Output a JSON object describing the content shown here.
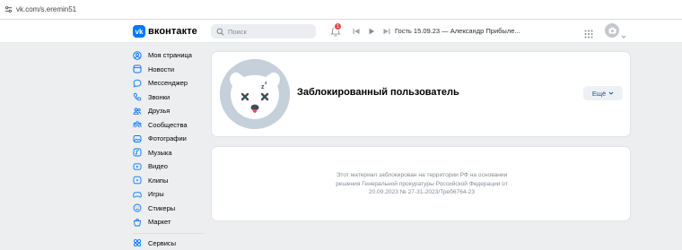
{
  "browser": {
    "url": "vk.com/s.eremin51"
  },
  "header": {
    "logo_text": "вконтакте",
    "logo_mark": "vk",
    "search_placeholder": "Поиск",
    "notification_count": "1",
    "now_playing": "Гость 15.09.23 — Александр Прибыле...",
    "accent_color": "#0077ff"
  },
  "sidebar": {
    "items": [
      {
        "label": "Моя страница",
        "icon": "user-circle-icon"
      },
      {
        "label": "Новости",
        "icon": "newsfeed-icon"
      },
      {
        "label": "Мессенджер",
        "icon": "message-icon"
      },
      {
        "label": "Звонки",
        "icon": "phone-icon"
      },
      {
        "label": "Друзья",
        "icon": "friends-icon"
      },
      {
        "label": "Сообщества",
        "icon": "groups-icon"
      },
      {
        "label": "Фотографии",
        "icon": "photo-icon"
      },
      {
        "label": "Музыка",
        "icon": "music-icon"
      },
      {
        "label": "Видео",
        "icon": "video-icon"
      },
      {
        "label": "Клипы",
        "icon": "clips-icon"
      },
      {
        "label": "Игры",
        "icon": "gamepad-icon"
      },
      {
        "label": "Стикеры",
        "icon": "sticker-icon"
      },
      {
        "label": "Маркет",
        "icon": "market-icon"
      }
    ],
    "extra": {
      "label": "Сервисы",
      "icon": "services-icon"
    }
  },
  "profile": {
    "name": "Заблокированный пользователь",
    "more_label": "Ещё"
  },
  "blocked_notice": {
    "line1": "Этот материал заблокирован на территории РФ на основании",
    "line2": "решения Генеральной прокуратуры Российской Федерации от",
    "line3": "20.09.2023 № 27-31-2023/Треб6764-23"
  }
}
